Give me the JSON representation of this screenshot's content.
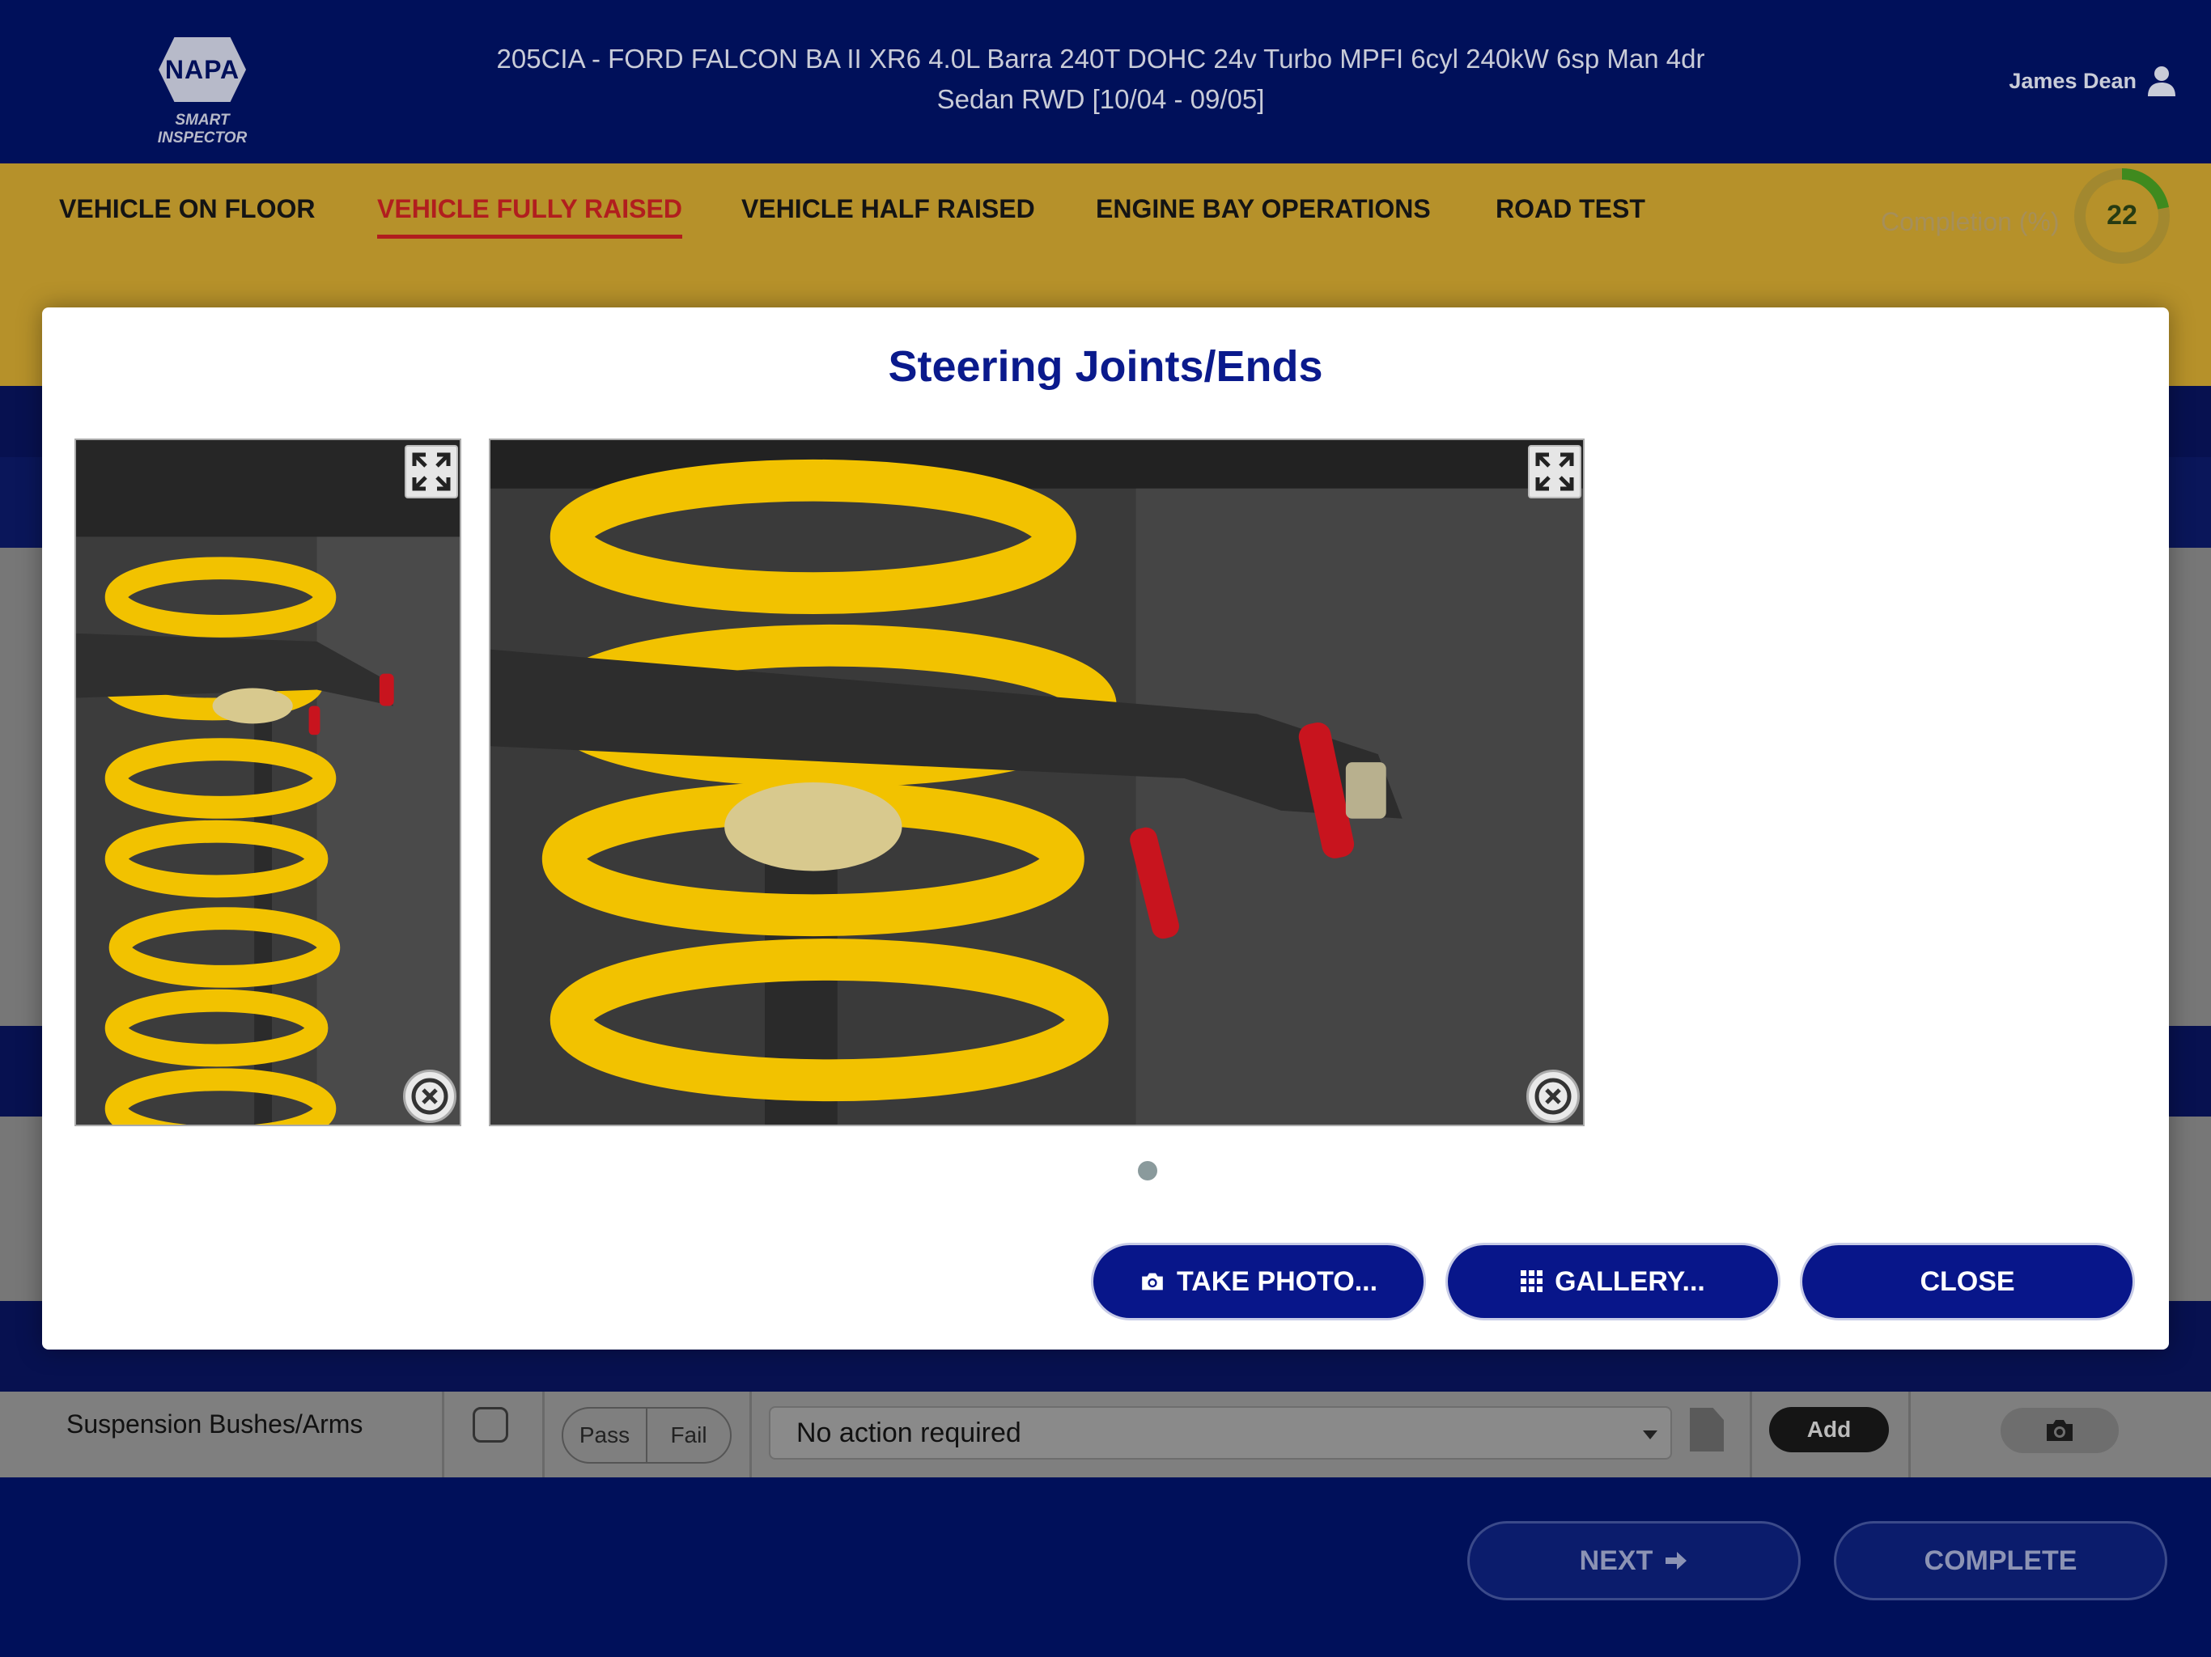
{
  "header": {
    "logo_text": "NAPA",
    "logo_subtitle": "SMART INSPECTOR",
    "vehicle_line1": "205CIA - FORD FALCON BA II XR6 4.0L Barra 240T DOHC 24v Turbo MPFI 6cyl 240kW 6sp Man 4dr",
    "vehicle_line2": "Sedan RWD [10/04 - 09/05]",
    "user_name": "James Dean",
    "user_icon": "user-icon"
  },
  "tabs": [
    {
      "label": "VEHICLE ON FLOOR",
      "active": false
    },
    {
      "label": "VEHICLE FULLY RAISED",
      "active": true
    },
    {
      "label": "VEHICLE HALF RAISED",
      "active": false
    },
    {
      "label": "ENGINE BAY OPERATIONS",
      "active": false
    },
    {
      "label": "ROAD TEST",
      "active": false
    }
  ],
  "completion": {
    "label": "Completion (%)",
    "value": "22",
    "fraction": 0.22
  },
  "colors": {
    "navy": "#00105a",
    "tab_bar": "#b6912a",
    "active_tab": "#b11e1e",
    "modal_button": "#08168a",
    "ring_progress": "#3f8a1e"
  },
  "background_row": {
    "label": "Suspension Bushes/Arms",
    "pass_label": "Pass",
    "fail_label": "Fail",
    "action_value": "No action required",
    "add_label": "Add"
  },
  "footer": {
    "next_label": "NEXT",
    "next_icon": "arrow-right-icon",
    "complete_label": "COMPLETE"
  },
  "modal": {
    "title": "Steering Joints/Ends",
    "photos": [
      {
        "name": "photo-1",
        "subject": "coil spring and suspension arm, portrait view"
      },
      {
        "name": "photo-2",
        "subject": "coil spring and suspension arm, close-up"
      }
    ],
    "take_photo_label": "TAKE PHOTO...",
    "take_photo_icon": "camera-icon",
    "gallery_label": "GALLERY...",
    "gallery_icon": "grid-icon",
    "close_label": "CLOSE"
  }
}
